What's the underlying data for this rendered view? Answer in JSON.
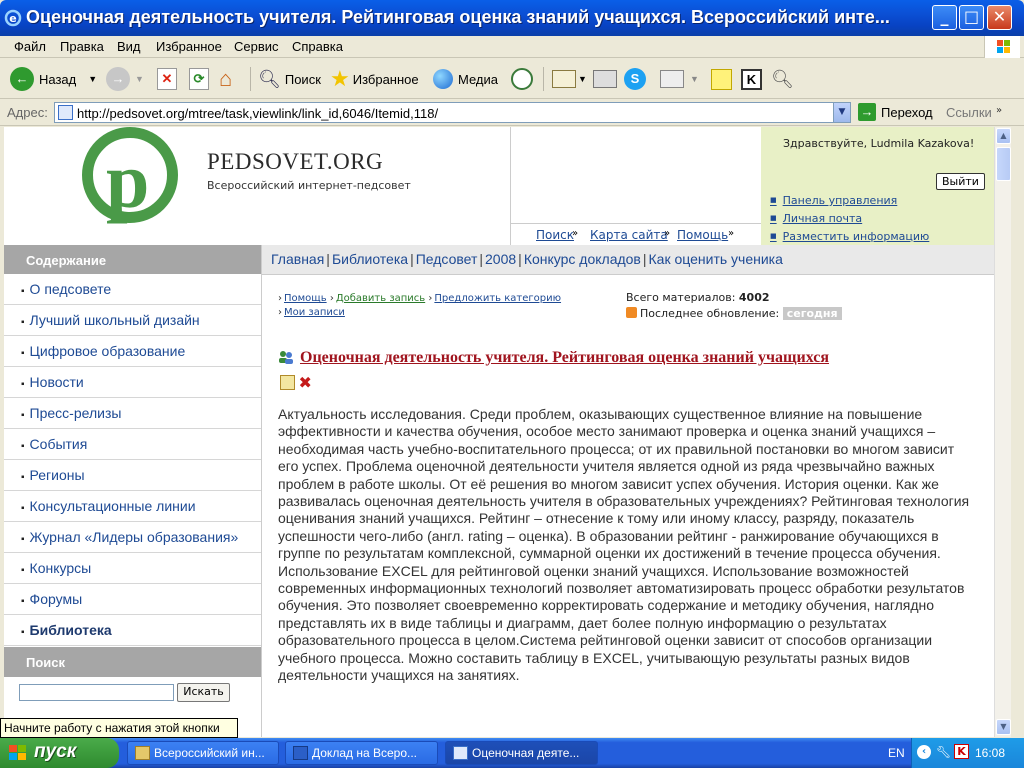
{
  "window": {
    "title": "Оценочная деятельность учителя. Рейтинговая оценка знаний учащихся. Всероссийский инте..."
  },
  "menu": [
    "Файл",
    "Правка",
    "Вид",
    "Избранное",
    "Сервис",
    "Справка"
  ],
  "toolbar": {
    "back": "Назад",
    "search": "Поиск",
    "favorites": "Избранное",
    "media": "Медиа"
  },
  "address": {
    "label": "Адрес:",
    "url": "http://pedsovet.org/mtree/task,viewlink/link_id,6046/Itemid,118/",
    "go": "Переход",
    "links": "Ссылки"
  },
  "site": {
    "brand": "PEDSOVET.ORG",
    "brand_sub": "Всероссийский интернет-педсовет",
    "header_links": [
      "Поиск",
      "Карта сайта",
      "Помощь"
    ],
    "greeting": "Здравствуйте, Ludmila Kazakova!",
    "logout": "Выйти",
    "user_links": [
      "Панель управления",
      "Личная почта",
      "Разместить информацию"
    ]
  },
  "sidebar": {
    "heading": "Содержание",
    "items": [
      "О педсовете",
      "Лучший школьный дизайн",
      "Цифровое образование",
      "Новости",
      "Пресс-релизы",
      "События",
      "Регионы",
      "Консультационные линии",
      "Журнал «Лидеры образования»",
      "Конкурсы",
      "Форумы",
      "Библиотека"
    ],
    "search_heading": "Поиск",
    "search_button": "Искать"
  },
  "breadcrumb": [
    "Главная",
    "Библиотека",
    "Педсовет",
    "2008",
    "Конкурс докладов",
    "Как оценить ученика"
  ],
  "actions": {
    "help": "Помощь",
    "add": "Добавить запись",
    "suggest": "Предложить категорию",
    "my": "Мои записи"
  },
  "stats": {
    "total_label": "Всего материалов:",
    "total": "4002",
    "updated_label": "Последнее обновление:",
    "updated": "сегодня"
  },
  "article": {
    "title": "Оценочная деятельность учителя. Рейтинговая оценка знаний учащихся",
    "body": "Актуальность исследования. Среди проблем, оказывающих существенное влияние на повышение эффективности и качества обучения, особое место занимают проверка и оценка знаний учащихся – необходимая часть учебно-воспитательного процесса; от их правильной постановки во многом зависит его успех. Проблема оценочной деятельности учителя является одной из ряда чрезвычайно важных проблем в работе школы. От её решения во многом зависит успех обучения. История оценки. Как же развивалась оценочная деятельность учителя в образовательных учреждениях? Рейтинговая технология оценивания знаний учащихся. Рейтинг – отнесение к тому или иному классу, разряду, показатель успешности чего-либо (англ. rating – оценка). В образовании рейтинг - ранжирование обучающихся в группе по результатам комплексной, суммарной оценки их достижений в течение процесса обучения. Использование EXCEL для рейтинговой оценки знаний учащихся. Использование возможностей современных информационных технологий позволяет автоматизировать процесс обработки результатов обучения. Это позволяет своевременно корректировать содержание и методику обучения, наглядно представлять их в виде таблицы и диаграмм, дает более полную информацию о результатах образовательного процесса в целом.Система рейтинговой оценки зависит от способов организации учебного процесса. Можно составить таблицу в EXCEL, учитывающую результаты разных видов деятельности учащихся на занятиях."
  },
  "tooltip": "Начните работу с нажатия этой кнопки",
  "taskbar": {
    "start": "пуск",
    "tasks": [
      "Всероссийский ин...",
      "Доклад на Всеро...",
      "Оценочная деяте..."
    ],
    "lang": "EN",
    "clock": "16:08"
  }
}
